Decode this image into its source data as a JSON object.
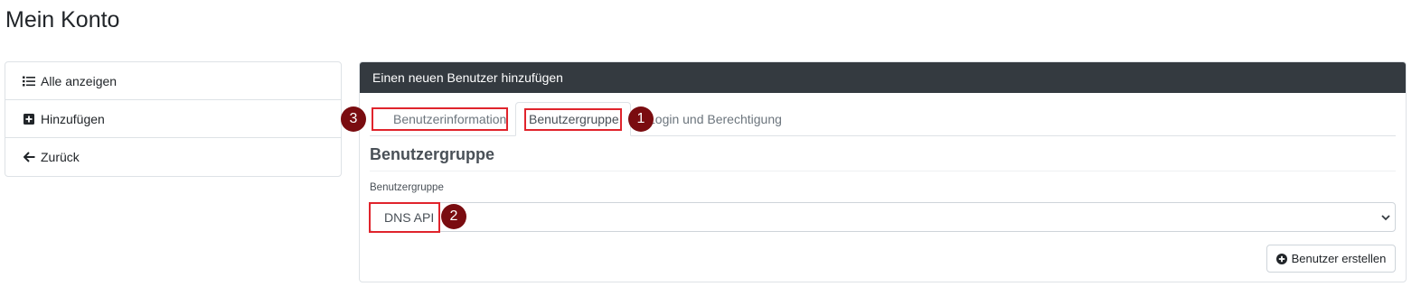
{
  "page": {
    "title": "Mein Konto"
  },
  "sidebar": {
    "items": [
      {
        "label": "Alle anzeigen",
        "icon": "list-icon"
      },
      {
        "label": "Hinzufügen",
        "icon": "plus-square-icon"
      },
      {
        "label": "Zurück",
        "icon": "arrow-left-icon"
      }
    ]
  },
  "card": {
    "header": "Einen neuen Benutzer hinzufügen",
    "tabs": [
      {
        "label": "Benutzerinformation",
        "active": false
      },
      {
        "label": "Benutzergruppe",
        "active": true
      },
      {
        "label": "Login und Berechtigung",
        "active": false
      }
    ],
    "section_title": "Benutzergruppe",
    "field_label": "Benutzergruppe",
    "select_value": "DNS API",
    "submit_label": "Benutzer erstellen"
  },
  "annotations": [
    {
      "number": "1"
    },
    {
      "number": "2"
    },
    {
      "number": "3"
    }
  ],
  "colors": {
    "header_bg": "#343a40",
    "highlight": "#e0242c",
    "badge": "#7a0c10"
  }
}
